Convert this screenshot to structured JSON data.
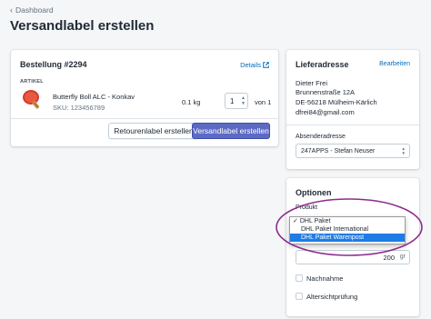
{
  "breadcrumb": {
    "label": "Dashboard"
  },
  "page": {
    "title": "Versandlabel erstellen"
  },
  "order": {
    "title": "Bestellung #2294",
    "details_link": "Details",
    "column_header": "ARTIKEL",
    "item": {
      "name": "Butterfly Boll ALC - Konkav",
      "sku": "SKU: 123456789",
      "weight": "0.1 kg",
      "quantity": "1",
      "quantity_of": "von 1"
    },
    "return_label_button": "Retourenlabel erstellen",
    "shipping_label_button": "Versandlabel erstellen"
  },
  "address": {
    "title": "Lieferadresse",
    "edit_link": "Bearbeiten",
    "lines": [
      "Dieter Frei",
      "Brunnenstraße 12A",
      "DE-56218 Mülheim-Kärlich",
      "dfrei84@gmail.com"
    ],
    "sender_label": "Absenderadresse",
    "sender_value": "247APPS - Stefan Neuser"
  },
  "options": {
    "title": "Optionen",
    "product_label": "Produkt",
    "product_options": [
      "DHL Paket",
      "DHL Paket International",
      "DHL Paket Warenpost"
    ],
    "selected_index": 0,
    "highlighted_index": 2,
    "weight_value": "200",
    "weight_unit": "gr",
    "nachnahme_label": "Nachnahme",
    "altersprufung_label": "Altersichtprüfung"
  },
  "colors": {
    "accent": "#5c6ac4",
    "link": "#006fbb",
    "highlight": "#1e7ce6",
    "annotation": "#8e2b8e"
  }
}
